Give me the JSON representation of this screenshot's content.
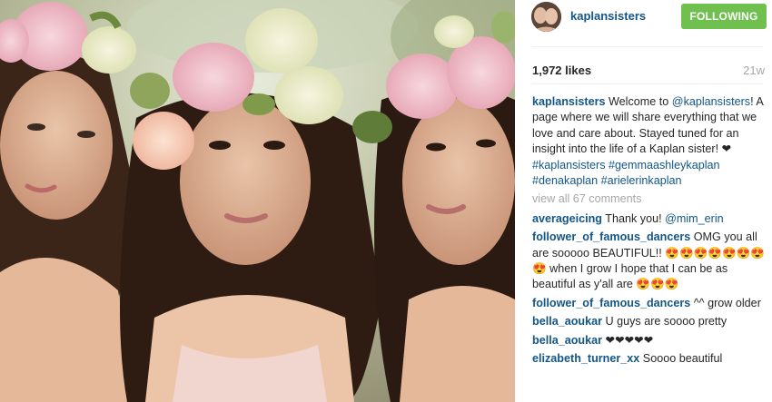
{
  "post": {
    "header": {
      "username": "kaplansisters",
      "follow_button": "FOLLOWING"
    },
    "likes": "1,972 likes",
    "timestamp": "21w",
    "caption": {
      "username": "kaplansisters",
      "text_1": " Welcome to ",
      "mention": "@kaplansisters",
      "text_2": "! A page where we will share everything that we love and care about. Stayed tuned for an insight into the life of a Kaplan sister! ❤ ",
      "hashtags": "#kaplansisters #gemmaashleykaplan #denakaplan #arielerinkaplan"
    },
    "view_all": "view all 67 comments",
    "comments": [
      {
        "username": "averageicing",
        "text": " Thank you! ",
        "mention": "@mim_erin"
      },
      {
        "username": "follower_of_famous_dancers",
        "text": " OMG you all are sooooo BEAUTIFUL!! 😍😍😍😍😍😍😍😍 when I grow I hope that I can be as beautiful as y'all are 😍😍😍"
      },
      {
        "username": "follower_of_famous_dancers",
        "text": " ^^ grow older"
      },
      {
        "username": "bella_aoukar",
        "text": " U guys are soooo pretty"
      },
      {
        "username": "bella_aoukar",
        "text": " ❤❤❤❤❤"
      },
      {
        "username": "elizabeth_turner_xx",
        "text": " Soooo beautiful"
      }
    ]
  },
  "colors": {
    "username": "#125688",
    "follow_button": "#70c050",
    "muted": "#a5a7aa"
  },
  "icons": {
    "avatar": "profile-photo"
  }
}
